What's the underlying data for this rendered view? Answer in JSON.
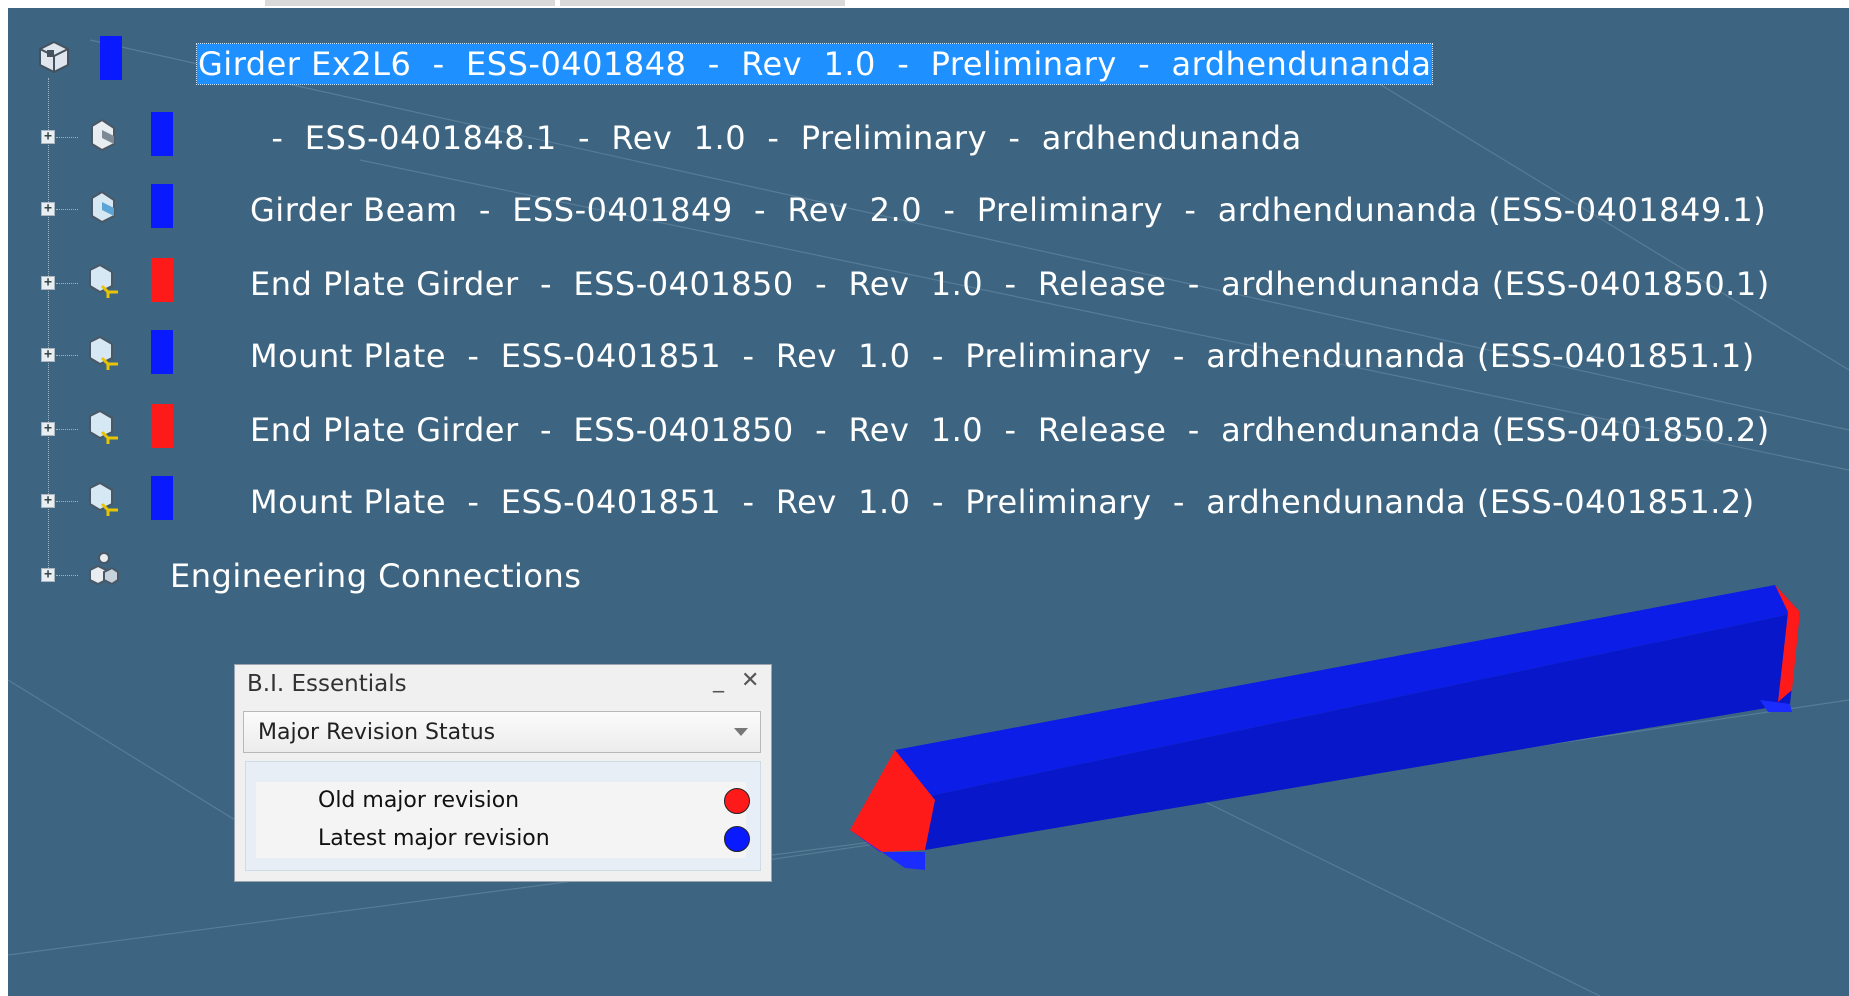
{
  "tree": {
    "root": {
      "label": "Girder Ex2L6  -  ESS-0401848  -  Rev  1.0  -  Preliminary  -  ardhendunanda",
      "status_color": "#0a1aff",
      "icon": "assembly-icon"
    },
    "children": [
      {
        "label": "  -  ESS-0401848.1  -  Rev  1.0  -  Preliminary  -  ardhendunanda",
        "status_color": "#0a1aff",
        "icon": "part-icon"
      },
      {
        "label": "Girder Beam  -  ESS-0401849  -  Rev  2.0  -  Preliminary  -  ardhendunanda (ESS-0401849.1)",
        "status_color": "#0a1aff",
        "icon": "part-icon"
      },
      {
        "label": "End Plate Girder  -  ESS-0401850  -  Rev  1.0  -  Release  -  ardhendunanda (ESS-0401850.1)",
        "status_color": "#ff1a1a",
        "icon": "part-instance-icon"
      },
      {
        "label": "Mount Plate  -  ESS-0401851  -  Rev  1.0  -  Preliminary  -  ardhendunanda (ESS-0401851.1)",
        "status_color": "#0a1aff",
        "icon": "part-instance-icon"
      },
      {
        "label": "End Plate Girder  -  ESS-0401850  -  Rev  1.0  -  Release  -  ardhendunanda (ESS-0401850.2)",
        "status_color": "#ff1a1a",
        "icon": "part-instance-icon"
      },
      {
        "label": "Mount Plate  -  ESS-0401851  -  Rev  1.0  -  Preliminary  -  ardhendunanda (ESS-0401851.2)",
        "status_color": "#0a1aff",
        "icon": "part-instance-icon"
      }
    ],
    "engineering": {
      "label": "Engineering Connections",
      "icon": "engineering-connections-icon"
    }
  },
  "panel": {
    "title": "B.I. Essentials",
    "minimize_label": "_",
    "close_label": "✕",
    "dropdown_value": "Major Revision Status",
    "legend": [
      {
        "label": "Old major revision",
        "color": "#ff1a1a"
      },
      {
        "label": "Latest major revision",
        "color": "#0a1aff"
      }
    ]
  },
  "colors": {
    "background": "#3d6480",
    "selection": "#1e90ff",
    "beam_blue": "#0a1aff",
    "beam_red": "#ff1a1a"
  }
}
